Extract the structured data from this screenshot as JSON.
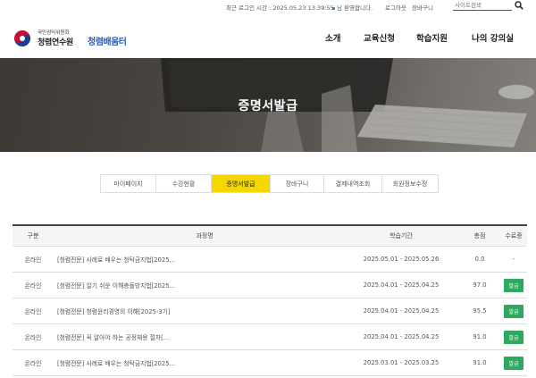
{
  "util": {
    "last_login": "최근 로그인 시간 : 2025.05.23 13:39:55",
    "welcome": "님 환영합니다.",
    "logout": "로그아웃",
    "cart": "장바구니",
    "search_placeholder": "사이트검색"
  },
  "logo": {
    "org": "국민권익위원회",
    "inst": "청렴연수원",
    "brand": "청렴배움터"
  },
  "gnb": [
    "소개",
    "교육신청",
    "학습지원",
    "나의 강의실"
  ],
  "hero": {
    "title": "증명서발급"
  },
  "tabs": [
    {
      "label": "마이페이지"
    },
    {
      "label": "수강현황"
    },
    {
      "label": "증명서발급"
    },
    {
      "label": "장바구니"
    },
    {
      "label": "결제내역조회"
    },
    {
      "label": "회원정보수정"
    }
  ],
  "table": {
    "headers": {
      "type": "구분",
      "course": "과정명",
      "period": "학습기간",
      "score": "총점",
      "cert": "수료증"
    },
    "rows": [
      {
        "type": "온라인",
        "course": "[청렴전문] 사례로 배우는 청탁금지법[2025...",
        "period": "2025.05.01 - 2025.05.26",
        "score": "0.0",
        "cert": "-"
      },
      {
        "type": "온라인",
        "course": "[청렴전문] 알기 쉬운 이해충돌방지법[2025...",
        "period": "2025.04.01 - 2025.04.25",
        "score": "97.0",
        "cert": "발급"
      },
      {
        "type": "온라인",
        "course": "[청렴전문] 청렴윤리경영의 이해[2025-3기]",
        "period": "2025.04.01 - 2025.04.25",
        "score": "95.5",
        "cert": "발급"
      },
      {
        "type": "온라인",
        "course": "[청렴전문] 꼭 알아야 하는 공정채용 절차[...",
        "period": "2025.04.01 - 2025.04.25",
        "score": "91.0",
        "cert": "발급"
      },
      {
        "type": "온라인",
        "course": "[청렴전문] 사례로 배우는 청탁금지법[2025...",
        "period": "2025.03.01 - 2025.03.25",
        "score": "91.0",
        "cert": "발급"
      }
    ]
  },
  "colors": {
    "active_tab": "#f5d800",
    "issue_button": "#2daa5f",
    "brand": "#2a5bb5"
  }
}
